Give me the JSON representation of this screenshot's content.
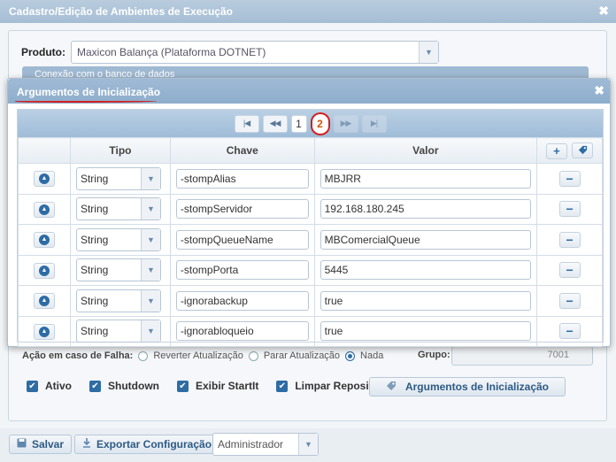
{
  "window": {
    "title": "Cadastro/Edição de Ambientes de Execução",
    "close_label": "✖"
  },
  "produto": {
    "label": "Produto:",
    "value": "Maxicon Balança (Plataforma DOTNET)"
  },
  "conexao": {
    "label": "Conexão com o banco de dados"
  },
  "falha": {
    "label": "Ação em caso de Falha:",
    "options": [
      "Reverter Atualização",
      "Parar Atualização",
      "Nada"
    ],
    "selected": "Nada",
    "grupo_label": "Grupo:",
    "grupo_value": "7001"
  },
  "checkboxes": [
    {
      "label": "Ativo",
      "checked": true
    },
    {
      "label": "Shutdown",
      "checked": true
    },
    {
      "label": "Exibir StartIt",
      "checked": true
    },
    {
      "label": "Limpar Repositorio",
      "checked": true
    }
  ],
  "argumentos_button": {
    "label": "Argumentos de Inicialização",
    "icon": "tag-icon"
  },
  "footer": {
    "save_label": "Salvar",
    "export_label": "Exportar Configuração",
    "user_value": "Administrador"
  },
  "modal": {
    "title": "Argumentos de Inicialização",
    "close_label": "✖",
    "pager": {
      "pages": [
        "1",
        "2"
      ],
      "current": "2"
    },
    "columns": {
      "tipo": "Tipo",
      "chave": "Chave",
      "valor": "Valor"
    },
    "rows": [
      {
        "tipo": "String",
        "chave": "-stompAlias",
        "valor": "MBJRR"
      },
      {
        "tipo": "String",
        "chave": "-stompServidor",
        "valor": "192.168.180.245"
      },
      {
        "tipo": "String",
        "chave": "-stompQueueName",
        "valor": "MBComercialQueue"
      },
      {
        "tipo": "String",
        "chave": "-stompPorta",
        "valor": "5445"
      },
      {
        "tipo": "String",
        "chave": "-ignorabackup",
        "valor": "true"
      },
      {
        "tipo": "String",
        "chave": "-ignorabloqueio",
        "valor": "true"
      }
    ]
  },
  "colors": {
    "accent": "#2e6ca4",
    "title_bar": "#9fbad5",
    "annotation": "#d21f1f",
    "active_page": "#d35400"
  }
}
